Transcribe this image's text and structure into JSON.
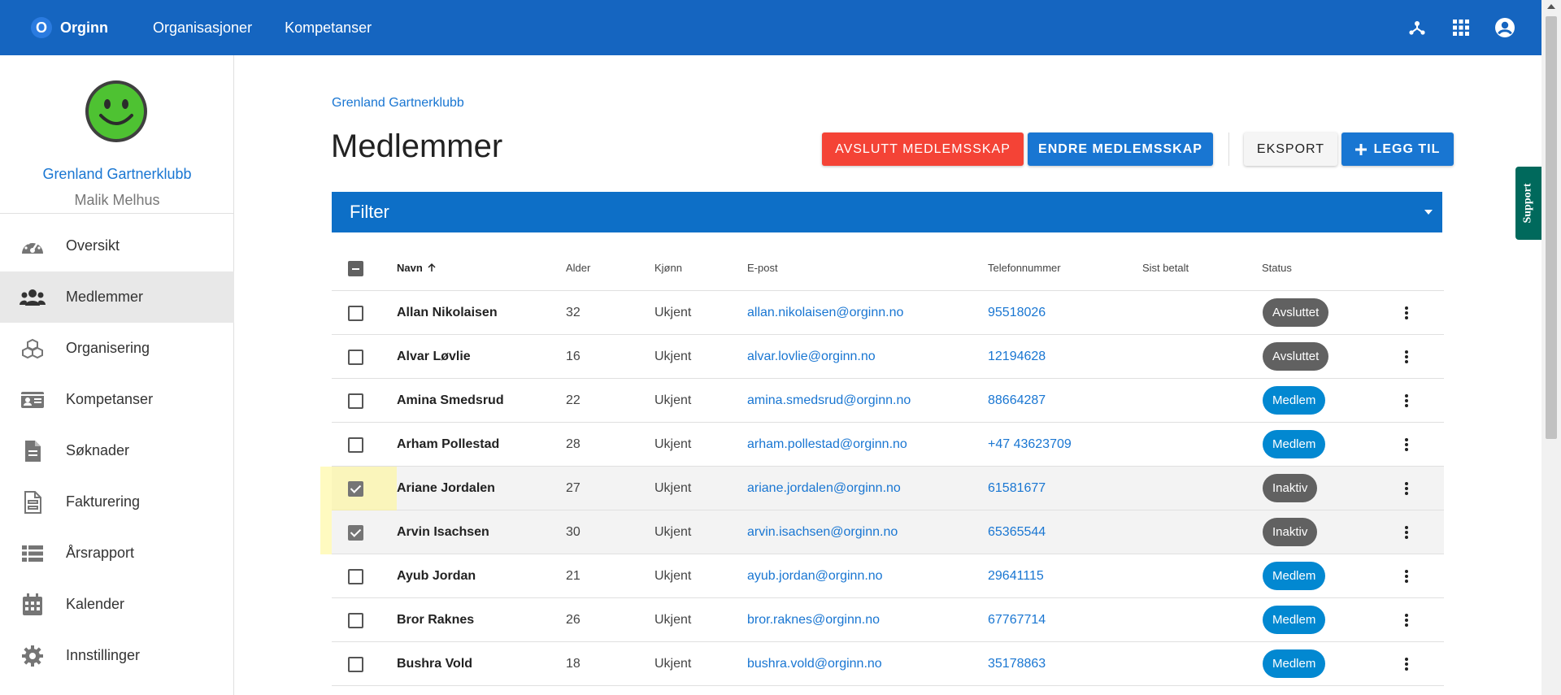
{
  "app": {
    "brand": "Orginn",
    "brand_letter": "O",
    "nav": [
      "Organisasjoner",
      "Kompetanser"
    ],
    "top_icons": [
      "hierarchy-icon",
      "apps-grid-icon",
      "account-circle-icon"
    ]
  },
  "sidebar": {
    "org_name": "Grenland Gartnerklubb",
    "user_name": "Malik Melhus",
    "items": [
      {
        "label": "Oversikt",
        "icon": "dashboard-icon"
      },
      {
        "label": "Medlemmer",
        "icon": "people-icon",
        "active": true
      },
      {
        "label": "Organisering",
        "icon": "cubes-icon"
      },
      {
        "label": "Kompetanser",
        "icon": "id-card-icon"
      },
      {
        "label": "Søknader",
        "icon": "document-icon"
      },
      {
        "label": "Fakturering",
        "icon": "invoice-icon"
      },
      {
        "label": "Årsrapport",
        "icon": "list-icon"
      },
      {
        "label": "Kalender",
        "icon": "calendar-icon"
      },
      {
        "label": "Innstillinger",
        "icon": "gear-icon"
      }
    ]
  },
  "main": {
    "breadcrumb": "Grenland Gartnerklubb",
    "title": "Medlemmer",
    "buttons": {
      "end_membership": "AVSLUTT MEDLEMSSKAP",
      "change_membership": "ENDRE MEDLEMSSKAP",
      "export": "EKSPORT",
      "add": "LEGG TIL"
    },
    "filter_label": "Filter"
  },
  "table": {
    "headers": {
      "name": "Navn",
      "age": "Alder",
      "gender": "Kjønn",
      "email": "E-post",
      "phone": "Telefonnummer",
      "last_paid": "Sist betalt",
      "status": "Status"
    },
    "rows": [
      {
        "name": "Allan Nikolaisen",
        "age": "32",
        "gender": "Ukjent",
        "email": "allan.nikolaisen@orginn.no",
        "phone": "95518026",
        "last_paid": "",
        "status": "Avsluttet",
        "status_type": "grey",
        "checked": false
      },
      {
        "name": "Alvar Løvlie",
        "age": "16",
        "gender": "Ukjent",
        "email": "alvar.lovlie@orginn.no",
        "phone": "12194628",
        "last_paid": "",
        "status": "Avsluttet",
        "status_type": "grey",
        "checked": false
      },
      {
        "name": "Amina Smedsrud",
        "age": "22",
        "gender": "Ukjent",
        "email": "amina.smedsrud@orginn.no",
        "phone": "88664287",
        "last_paid": "",
        "status": "Medlem",
        "status_type": "blue",
        "checked": false
      },
      {
        "name": "Arham Pollestad",
        "age": "28",
        "gender": "Ukjent",
        "email": "arham.pollestad@orginn.no",
        "phone": "+47 43623709",
        "last_paid": "",
        "status": "Medlem",
        "status_type": "blue",
        "checked": false
      },
      {
        "name": "Ariane Jordalen",
        "age": "27",
        "gender": "Ukjent",
        "email": "ariane.jordalen@orginn.no",
        "phone": "61581677",
        "last_paid": "",
        "status": "Inaktiv",
        "status_type": "grey",
        "checked": true
      },
      {
        "name": "Arvin Isachsen",
        "age": "30",
        "gender": "Ukjent",
        "email": "arvin.isachsen@orginn.no",
        "phone": "65365544",
        "last_paid": "",
        "status": "Inaktiv",
        "status_type": "grey",
        "checked": true
      },
      {
        "name": "Ayub Jordan",
        "age": "21",
        "gender": "Ukjent",
        "email": "ayub.jordan@orginn.no",
        "phone": "29641115",
        "last_paid": "",
        "status": "Medlem",
        "status_type": "blue",
        "checked": false
      },
      {
        "name": "Bror Raknes",
        "age": "26",
        "gender": "Ukjent",
        "email": "bror.raknes@orginn.no",
        "phone": "67767714",
        "last_paid": "",
        "status": "Medlem",
        "status_type": "blue",
        "checked": false
      },
      {
        "name": "Bushra Vold",
        "age": "18",
        "gender": "Ukjent",
        "email": "bushra.vold@orginn.no",
        "phone": "35178863",
        "last_paid": "",
        "status": "Medlem",
        "status_type": "blue",
        "checked": false
      }
    ]
  },
  "support_label": "Support",
  "colors": {
    "primary": "#1565c0",
    "danger": "#f44336",
    "member_chip": "#0288d1",
    "inactive_chip": "#616161",
    "support": "#00695c"
  }
}
